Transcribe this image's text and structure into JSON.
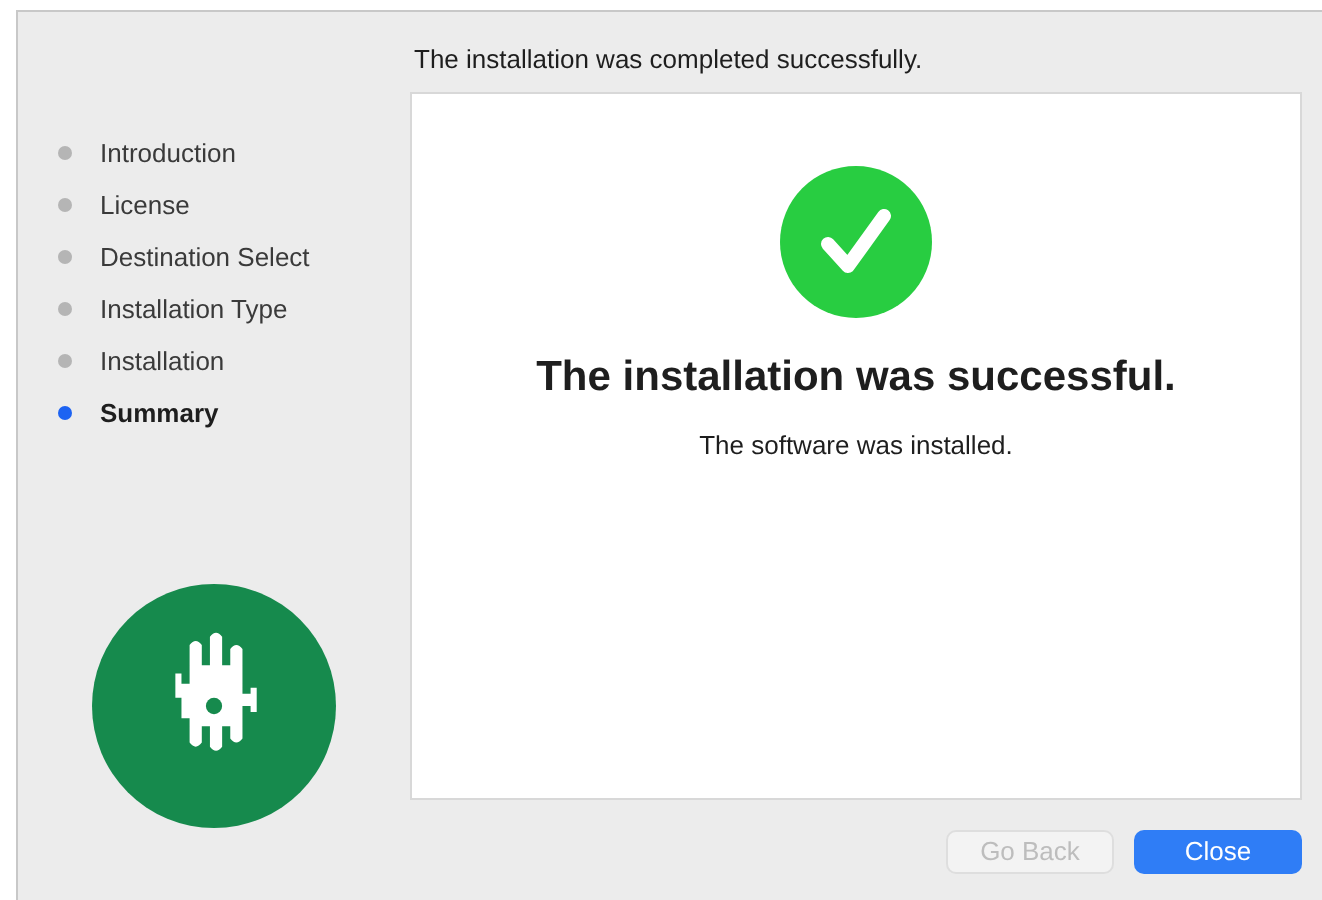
{
  "header": "The installation was completed successfully.",
  "steps": [
    {
      "label": "Introduction",
      "selected": false
    },
    {
      "label": "License",
      "selected": false
    },
    {
      "label": "Destination Select",
      "selected": false
    },
    {
      "label": "Installation Type",
      "selected": false
    },
    {
      "label": "Installation",
      "selected": false
    },
    {
      "label": "Summary",
      "selected": true
    }
  ],
  "content": {
    "title": "The installation was successful.",
    "message": "The software was installed."
  },
  "buttons": [
    {
      "label": "Go Back",
      "disabled": true,
      "kind": "secondary"
    },
    {
      "label": "Close",
      "disabled": false,
      "kind": "primary"
    }
  ]
}
